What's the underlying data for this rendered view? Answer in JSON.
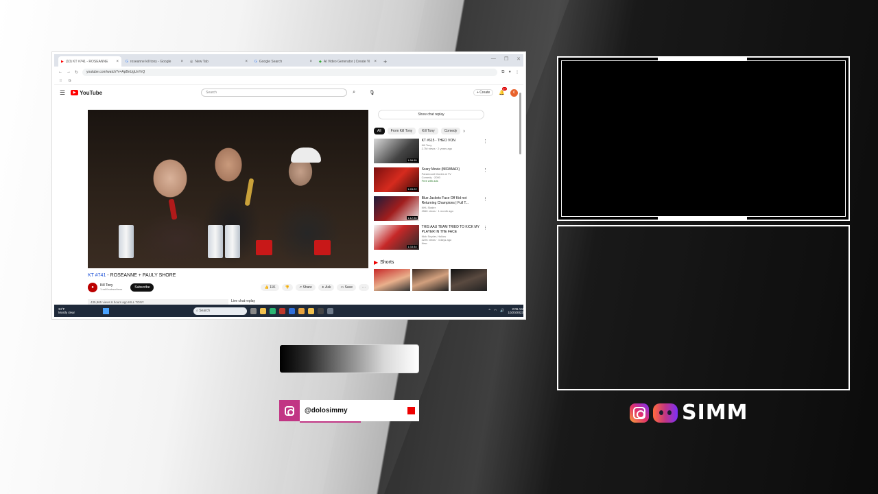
{
  "browser": {
    "tabs": [
      {
        "label": "(10) KT #741 - ROSEANNE",
        "active": true
      },
      {
        "label": "roseanne kill tony - Google",
        "active": false
      },
      {
        "label": "New Tab",
        "active": false
      },
      {
        "label": "Google Search",
        "active": false
      },
      {
        "label": "AI Video Generator | Create Vi",
        "active": false
      }
    ],
    "new_tab": "+",
    "window_controls": [
      "—",
      "❐",
      "✕"
    ],
    "url": "youtube.com/watch?v=ApBnUgUnYrQ",
    "bookmark": "G"
  },
  "youtube": {
    "logo_text": "YouTube",
    "search_placeholder": "Search",
    "create_label": "Create",
    "notif_count": "9+",
    "avatar_initial": "c",
    "video_title_hash": "KT #741",
    "video_title_rest": " - ROSEANNE + PAULY SHORE",
    "channel_name": "Kill Tony",
    "channel_subs": "1.xxM subscribers",
    "subscribe_label": "Subscribe",
    "like_count": "11K",
    "share_label": "Share",
    "ask_label": "Ask",
    "save_label": "Save",
    "more_label": "···",
    "description": "435,965 views  6 hours ago  KILL TONY",
    "live_chat_replay": "Live chat replay",
    "show_chat_replay": "Show chat replay",
    "chips": [
      "All",
      "From Kill Tony",
      "Kill Tony",
      "Comedy"
    ],
    "recommended": [
      {
        "title": "KT #615 - THEO VON",
        "channel": "Kill Tony",
        "meta": "2.7M views · 2 years ago",
        "duration": "1:58:35"
      },
      {
        "title": "Scary Movie (MIRAMAX)",
        "channel": "Paramount Movies & TV",
        "meta": "Comedy · 2000",
        "extra": "Free with ads",
        "duration": "1:28:22"
      },
      {
        "title": "Blue Jackets Face Off Kid not Returning Champions | Full T...",
        "channel": "NHL Skater",
        "meta": "256K views · 1 month ago",
        "duration": "1:12:36"
      },
      {
        "title": "THIS AAU TEAM TRIED TO KICK MY PLAYER IN THE FACE",
        "channel": "Nick Snyder, Hollow",
        "meta": "222K views · 4 days ago",
        "extra": "New",
        "duration": "1:33:34"
      }
    ],
    "shorts_label": "Shorts"
  },
  "taskbar": {
    "weather_temp": "34°F",
    "weather_desc": "Mostly clear",
    "search_placeholder": "Search",
    "time": "2:06 AM",
    "date": "10/20/2023"
  },
  "overlay": {
    "ig_handle": "@dolosimmy",
    "brand_name": "SIMM"
  },
  "colors": {
    "ig_accent": "#c13584",
    "rec_red": "#e00000",
    "youtube_red": "#ff0000"
  }
}
